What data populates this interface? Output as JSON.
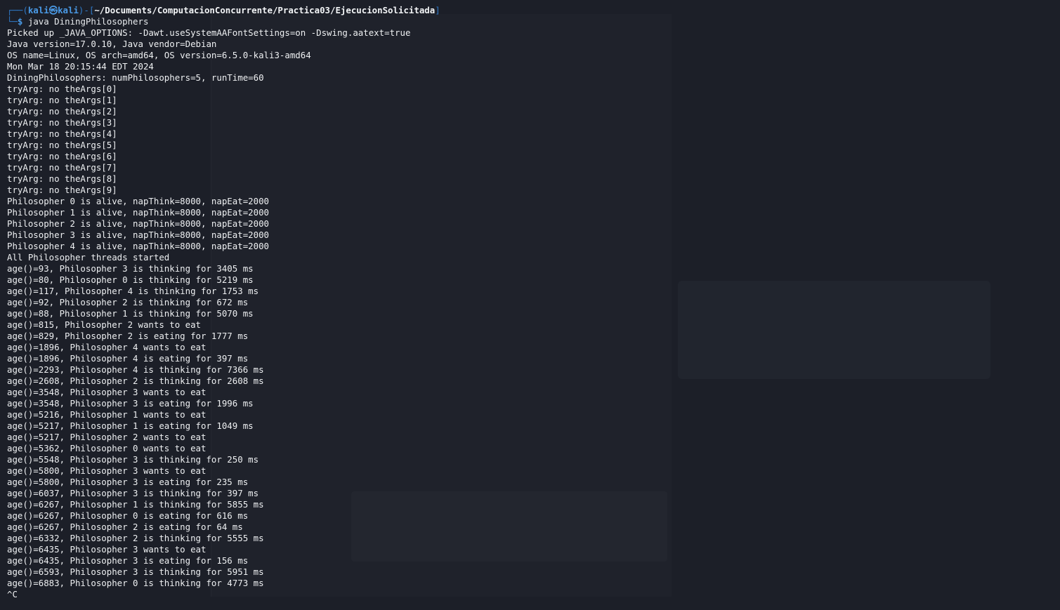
{
  "prompt": {
    "top_frame": "┌──(",
    "user": "kali",
    "at": "㉿",
    "host": "kali",
    "mid_frame": ")-[",
    "cwd": "~/Documents/ComputacionConcurrente/Practica03/EjecucionSolicitada",
    "close_frame": "]",
    "bottom_frame": "└─",
    "dollar": "$",
    "command": "java DiningPhilosophers"
  },
  "output_lines": [
    "Picked up _JAVA_OPTIONS: -Dawt.useSystemAAFontSettings=on -Dswing.aatext=true",
    "Java version=17.0.10, Java vendor=Debian",
    "OS name=Linux, OS arch=amd64, OS version=6.5.0-kali3-amd64",
    "Mon Mar 18 20:15:44 EDT 2024",
    "DiningPhilosophers: numPhilosophers=5, runTime=60",
    "tryArg: no theArgs[0]",
    "tryArg: no theArgs[1]",
    "tryArg: no theArgs[2]",
    "tryArg: no theArgs[3]",
    "tryArg: no theArgs[4]",
    "tryArg: no theArgs[5]",
    "tryArg: no theArgs[6]",
    "tryArg: no theArgs[7]",
    "tryArg: no theArgs[8]",
    "tryArg: no theArgs[9]",
    "Philosopher 0 is alive, napThink=8000, napEat=2000",
    "Philosopher 1 is alive, napThink=8000, napEat=2000",
    "Philosopher 2 is alive, napThink=8000, napEat=2000",
    "Philosopher 3 is alive, napThink=8000, napEat=2000",
    "Philosopher 4 is alive, napThink=8000, napEat=2000",
    "All Philosopher threads started",
    "age()=93, Philosopher 3 is thinking for 3405 ms",
    "age()=80, Philosopher 0 is thinking for 5219 ms",
    "age()=117, Philosopher 4 is thinking for 1753 ms",
    "age()=92, Philosopher 2 is thinking for 672 ms",
    "age()=88, Philosopher 1 is thinking for 5070 ms",
    "age()=815, Philosopher 2 wants to eat",
    "age()=829, Philosopher 2 is eating for 1777 ms",
    "age()=1896, Philosopher 4 wants to eat",
    "age()=1896, Philosopher 4 is eating for 397 ms",
    "age()=2293, Philosopher 4 is thinking for 7366 ms",
    "age()=2608, Philosopher 2 is thinking for 2608 ms",
    "age()=3548, Philosopher 3 wants to eat",
    "age()=3548, Philosopher 3 is eating for 1996 ms",
    "age()=5216, Philosopher 1 wants to eat",
    "age()=5217, Philosopher 1 is eating for 1049 ms",
    "age()=5217, Philosopher 2 wants to eat",
    "age()=5362, Philosopher 0 wants to eat",
    "age()=5548, Philosopher 3 is thinking for 250 ms",
    "age()=5800, Philosopher 3 wants to eat",
    "age()=5800, Philosopher 3 is eating for 235 ms",
    "age()=6037, Philosopher 3 is thinking for 397 ms",
    "age()=6267, Philosopher 1 is thinking for 5855 ms",
    "age()=6267, Philosopher 0 is eating for 616 ms",
    "age()=6267, Philosopher 2 is eating for 64 ms",
    "age()=6332, Philosopher 2 is thinking for 5555 ms",
    "age()=6435, Philosopher 3 wants to eat",
    "age()=6435, Philosopher 3 is eating for 156 ms",
    "age()=6593, Philosopher 3 is thinking for 5951 ms",
    "age()=6883, Philosopher 0 is thinking for 4773 ms",
    "^C"
  ],
  "colors": {
    "background": "#1c1f28",
    "text": "#eef0f2",
    "prompt_frame": "#2f7ac8",
    "prompt_user": "#4a9be8"
  }
}
